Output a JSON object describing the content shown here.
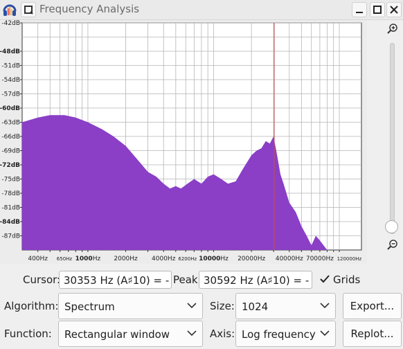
{
  "window": {
    "title": "Frequency Analysis",
    "accent": "#8a3fc6",
    "cursor_line_color": "#c05050"
  },
  "plot": {
    "y_labels": [
      {
        "text": "-42dB",
        "bold": false
      },
      {
        "text": "-48dB",
        "bold": true
      },
      {
        "text": "-51dB",
        "bold": false
      },
      {
        "text": "-54dB",
        "bold": false
      },
      {
        "text": "-57dB",
        "bold": false
      },
      {
        "text": "-60dB",
        "bold": true
      },
      {
        "text": "-63dB",
        "bold": false
      },
      {
        "text": "-66dB",
        "bold": false
      },
      {
        "text": "-69dB",
        "bold": false
      },
      {
        "text": "-72dB",
        "bold": true
      },
      {
        "text": "-75dB",
        "bold": false
      },
      {
        "text": "-78dB",
        "bold": false
      },
      {
        "text": "-81dB",
        "bold": false
      },
      {
        "text": "-84dB",
        "bold": true
      },
      {
        "text": "-87dB",
        "bold": false
      }
    ],
    "x_labels": [
      {
        "text": "400Hz",
        "small": false
      },
      {
        "text": "650Hz",
        "small": true
      },
      {
        "text": "1000Hz",
        "small": false,
        "bold_prefix": "1000"
      },
      {
        "text": "2000Hz",
        "small": false
      },
      {
        "text": "4000Hz",
        "small": false
      },
      {
        "text": "6200Hz",
        "small": true
      },
      {
        "text": "10000Hz",
        "small": false,
        "bold_prefix": "10000"
      },
      {
        "text": "20000Hz",
        "small": false
      },
      {
        "text": "40000Hz",
        "small": false
      },
      {
        "text": "70000Hz",
        "small": false
      },
      {
        "text": "120000Hz",
        "small": true
      }
    ],
    "grid": true
  },
  "chart_data": {
    "type": "area",
    "x_scale": "log",
    "y_range_db": [
      -90,
      -42
    ],
    "x_range_hz": [
      300,
      150000
    ],
    "cursor_hz": 30353,
    "x": [
      300,
      400,
      500,
      650,
      800,
      1000,
      1300,
      1600,
      2000,
      2500,
      3000,
      3500,
      4000,
      4500,
      5000,
      5500,
      6200,
      7000,
      8000,
      9000,
      10000,
      11500,
      13000,
      15000,
      17000,
      20000,
      22000,
      24000,
      26000,
      28000,
      30000,
      32000,
      34000,
      36000,
      40000,
      45000,
      50000,
      55000,
      60000,
      65000,
      70000,
      80000
    ],
    "values": [
      -63,
      -62,
      -61.5,
      -61.5,
      -62,
      -63,
      -64.5,
      -66,
      -68,
      -71,
      -73.5,
      -74.5,
      -76,
      -77,
      -76.5,
      -77,
      -76,
      -75,
      -76,
      -74.5,
      -74,
      -75,
      -76,
      -75.5,
      -73,
      -70,
      -69,
      -68.5,
      -67,
      -67.5,
      -66,
      -70,
      -74,
      -76,
      -80,
      -82,
      -85,
      -87,
      -89,
      -87,
      -88,
      -90
    ]
  },
  "controls": {
    "cursor_label": "Cursor:",
    "cursor_value": "30353 Hz (A♯10) = -",
    "peak_label": "Peak:",
    "peak_value": "30592 Hz (A♯10) = -",
    "grids_label": "Grids",
    "grids_checked": true,
    "algorithm_label": "Algorithm:",
    "algorithm_value": "Spectrum",
    "size_label": "Size:",
    "size_value": "1024",
    "export_label": "Export...",
    "function_label": "Function:",
    "function_value": "Rectangular window",
    "axis_label": "Axis:",
    "axis_value": "Log frequency",
    "replot_label": "Replot..."
  }
}
